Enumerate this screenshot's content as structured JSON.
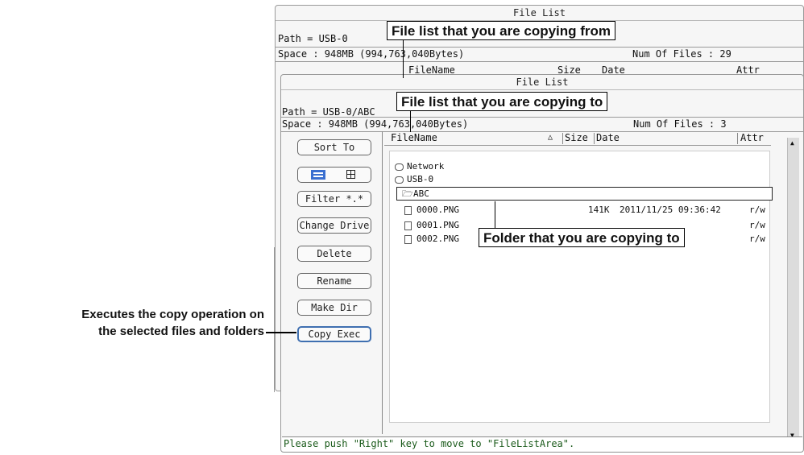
{
  "back_window": {
    "title": "File List",
    "path": "Path = USB-0",
    "space": "Space : 948MB (994,763,040Bytes)",
    "num_files": "Num Of Files : 29",
    "col_filename": "FileName",
    "col_size": "Size",
    "col_date": "Date",
    "col_attr": "Attr"
  },
  "front_window": {
    "title": "File List",
    "path": "Path = USB-0/ABC",
    "space": "Space : 948MB (994,763,040Bytes)",
    "num_files": "Num Of Files : 3",
    "columns": {
      "filename": "FileName",
      "size": "Size",
      "date": "Date",
      "attr": "Attr"
    },
    "sort_arrow": "△",
    "buttons": {
      "sort": "Sort To",
      "filter": "Filter  *.*",
      "change_drive": "Change Drive",
      "delete": "Delete",
      "rename": "Rename",
      "make_dir": "Make Dir",
      "copy_exec": "Copy Exec"
    },
    "tree": {
      "network": "Network",
      "usb": "USB-0",
      "folder": "ABC"
    },
    "files": [
      {
        "name": "0000.PNG",
        "size": "141K",
        "date": "2011/11/25 09:36:42",
        "attr": "r/w"
      },
      {
        "name": "0001.PNG",
        "size": "",
        "date": "",
        "attr": "r/w"
      },
      {
        "name": "0002.PNG",
        "size": "",
        "date": "",
        "attr": "r/w"
      }
    ],
    "status": "Please push \"Right\" key to move to \"FileListArea\"."
  },
  "callouts": {
    "copying_from": "File list that you are copying from",
    "copying_to": "File list that you are copying to",
    "folder_to": "Folder that you are copying to"
  },
  "annotation": {
    "line1": "Executes the copy operation on",
    "line2": "the selected files and folders"
  }
}
